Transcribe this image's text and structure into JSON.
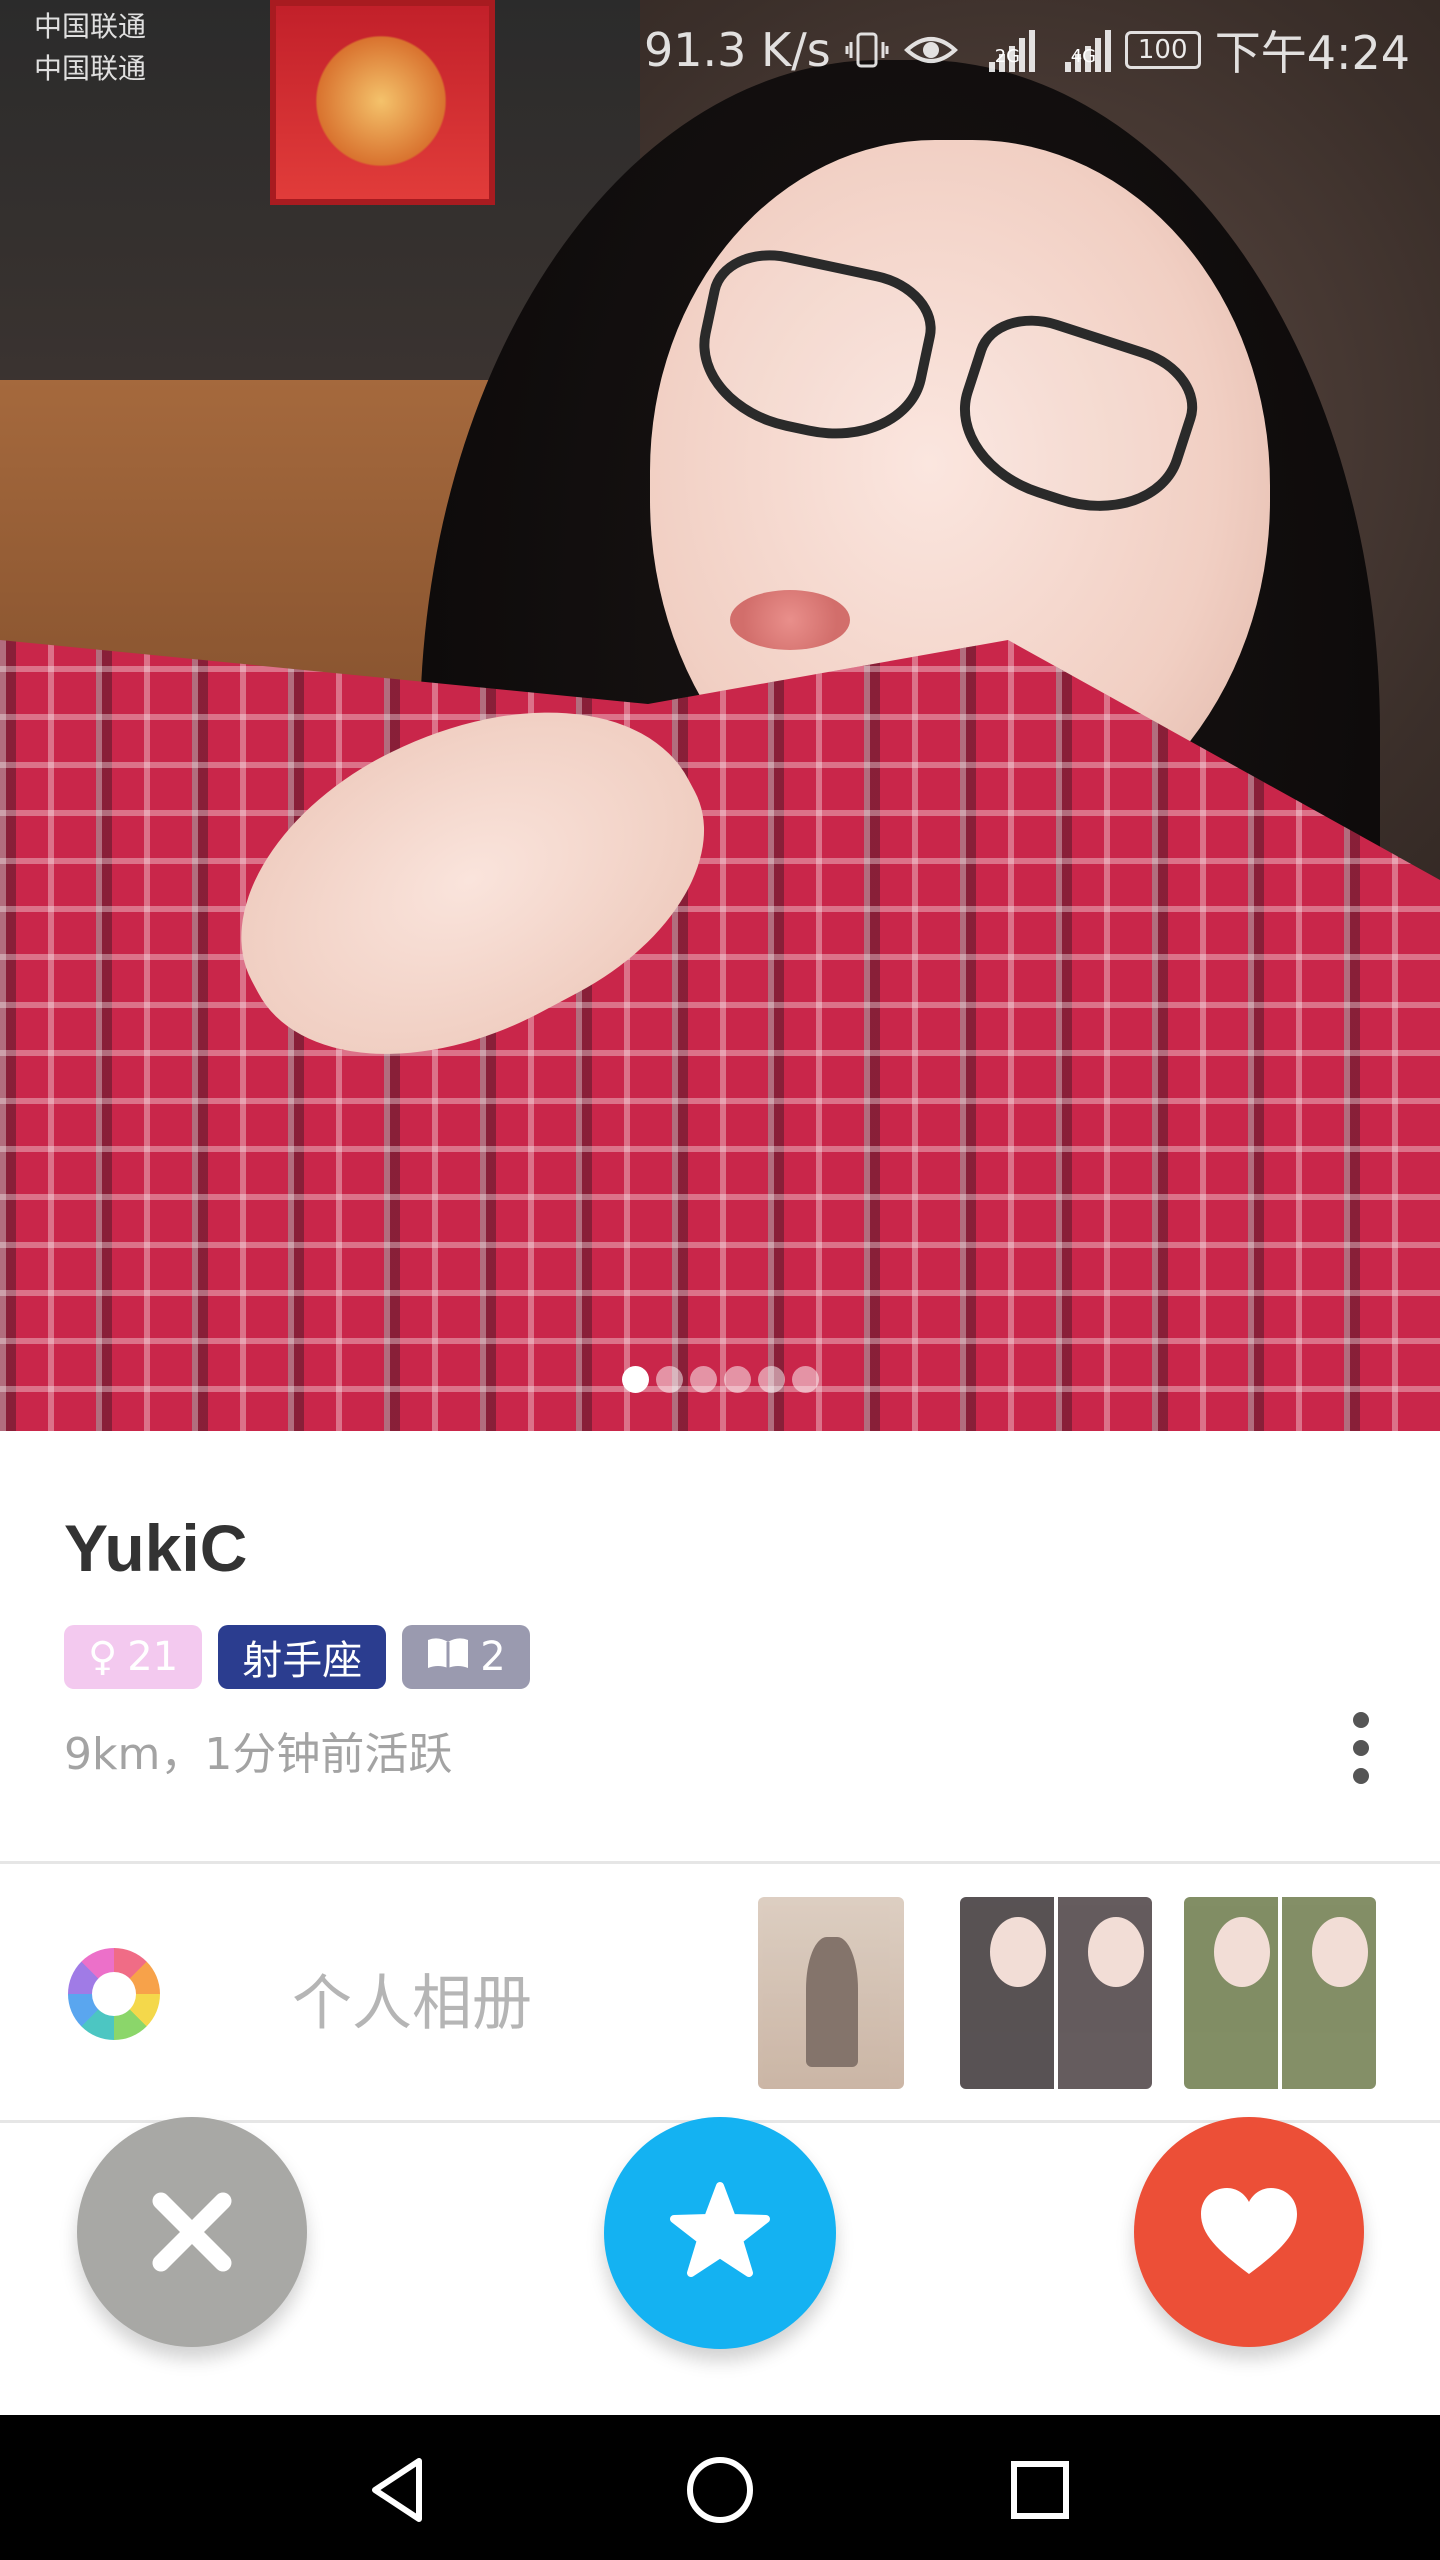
{
  "status_bar": {
    "carrier_1": "中国联通",
    "carrier_2": "中国联通",
    "network_speed": "91.3 K/s",
    "signal_1_tag": "2G",
    "signal_2_tag": "4G",
    "battery": "100",
    "time": "下午4:24",
    "icons": [
      "vibrate-icon",
      "eye-icon",
      "signal-2g-icon",
      "signal-4g-icon",
      "battery-icon"
    ]
  },
  "photo_carousel": {
    "total_pages": 6,
    "current_page": 1
  },
  "profile": {
    "name": "YukiC",
    "gender_symbol": "♀",
    "age": "21",
    "zodiac": "射手座",
    "book_count": "2",
    "distance_activity": "9km，1分钟前活跃"
  },
  "album": {
    "label": "个人相册",
    "thumbnail_count": 3
  },
  "actions": {
    "dislike_icon": "close-icon",
    "superlike_icon": "star-icon",
    "like_icon": "heart-icon"
  },
  "colors": {
    "dislike": "#a8a8a5",
    "superlike": "#14b2f2",
    "like": "#ec4f37",
    "gender_tag": "#f3c9ef",
    "zodiac_tag": "#2b3d8f",
    "book_tag": "#9a9aaf"
  }
}
